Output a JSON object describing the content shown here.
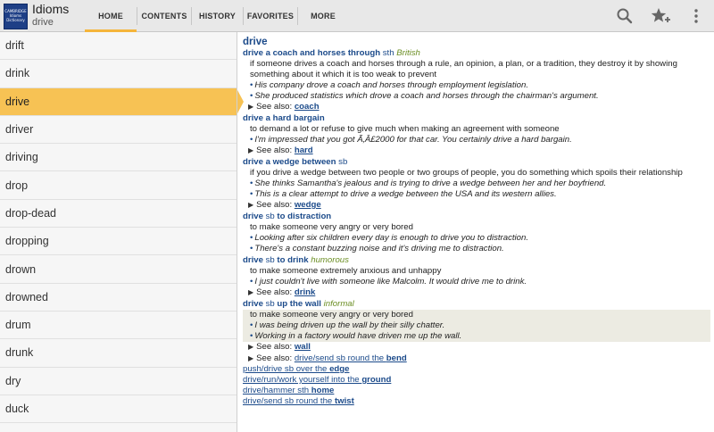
{
  "app": {
    "logo_text": "CAMBRIDGE Idioms Dictionary",
    "title": "Idioms",
    "subtitle": "drive"
  },
  "tabs": [
    {
      "label": "HOME",
      "active": true
    },
    {
      "label": "CONTENTS",
      "active": false
    },
    {
      "label": "HISTORY",
      "active": false
    },
    {
      "label": "FAVORITES",
      "active": false
    },
    {
      "label": "MORE",
      "active": false
    }
  ],
  "actions": [
    "search-icon",
    "add-favorite-star-icon",
    "overflow-menu-icon"
  ],
  "accent_color": "#f5b53b",
  "word_list": [
    "drift",
    "drink",
    "drive",
    "driver",
    "driving",
    "drop",
    "drop-dead",
    "dropping",
    "drown",
    "drowned",
    "drum",
    "drunk",
    "dry",
    "duck"
  ],
  "selected_word_index": 2,
  "entry": {
    "headword": "drive",
    "idioms": [
      {
        "p1": "drive a coach and horses through",
        "p2": " sth",
        "p3": "",
        "label": "British",
        "definition": "if someone drives a coach and horses through a rule, an opinion, a plan, or a tradition, they destroy it by showing something about it which it is too weak to prevent",
        "examples": [
          "His company drove a coach and horses through employment legislation.",
          "She produced statistics which drove a coach and horses through the chairman's argument."
        ],
        "see_also_label": "See also:",
        "see_also": "coach"
      },
      {
        "p1": "drive a hard bargain",
        "p2": "",
        "p3": "",
        "label": "",
        "definition": "to demand a lot or refuse to give much when making an agreement with someone",
        "examples": [
          "I'm impressed that you got Ã‚Â£2000 for that car. You certainly drive a hard bargain."
        ],
        "see_also_label": "See also:",
        "see_also": "hard"
      },
      {
        "p1": "drive a wedge between",
        "p2": " sb",
        "p3": "",
        "label": "",
        "definition": "if you drive a wedge between two people or two groups of people, you do something which spoils their relationship",
        "examples": [
          "She thinks Samantha's jealous and is trying to drive a wedge between her and her boyfriend.",
          "This is a clear attempt to drive a wedge between the USA and its western allies."
        ],
        "see_also_label": "See also:",
        "see_also": "wedge"
      },
      {
        "p1": "drive",
        "p2": " sb ",
        "p3": "to distraction",
        "label": "",
        "definition": "to make someone very angry or very bored",
        "examples": [
          "Looking after six children every day is enough to drive you to distraction.",
          "There's a constant buzzing noise and it's driving me to distraction."
        ],
        "see_also_label": "",
        "see_also": ""
      },
      {
        "p1": "drive",
        "p2": " sb ",
        "p3": "to drink",
        "label": "humorous",
        "definition": "to make someone extremely anxious and unhappy",
        "examples": [
          "I just couldn't live with someone like Malcolm. It would drive me to drink."
        ],
        "see_also_label": "See also:",
        "see_also": "drink"
      },
      {
        "p1": "drive",
        "p2": " sb ",
        "p3": "up the wall",
        "label": "informal",
        "definition": "to make someone very angry or very bored",
        "examples": [
          "I was being driven up the wall by their silly chatter.",
          "Working in a factory would have driven me up the wall."
        ],
        "see_also_label": "See also:",
        "see_also": "wall"
      }
    ],
    "footer_see_also_label": "See also:",
    "cross_refs": [
      {
        "plain": "drive/send sb round the ",
        "bold": "bend"
      },
      {
        "plain": "push/drive sb over the ",
        "bold": "edge"
      },
      {
        "plain": "drive/run/work yourself into the ",
        "bold": "ground"
      },
      {
        "plain": "drive/hammer sth ",
        "bold": "home"
      },
      {
        "plain": "drive/send sb round the ",
        "bold": "twist"
      }
    ]
  }
}
